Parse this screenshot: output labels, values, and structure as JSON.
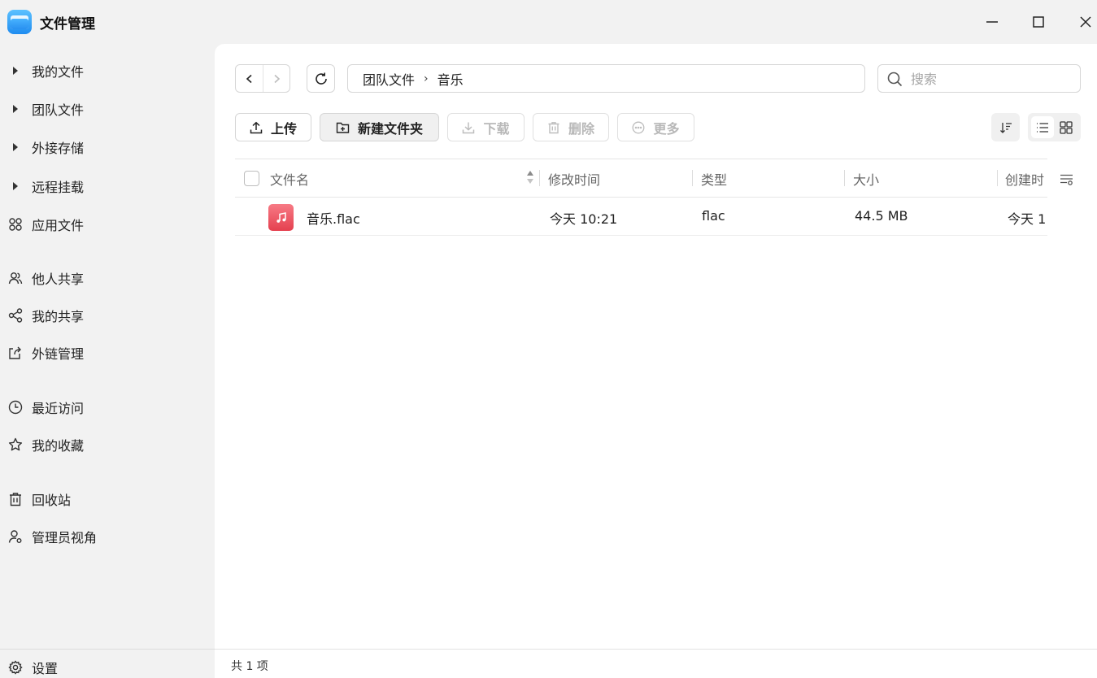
{
  "app": {
    "title": "文件管理"
  },
  "sidebar": {
    "tree_items": [
      {
        "label": "我的文件"
      },
      {
        "label": "团队文件"
      },
      {
        "label": "外接存储"
      },
      {
        "label": "远程挂载"
      }
    ],
    "app_files": {
      "label": "应用文件"
    },
    "share_items": [
      {
        "label": "他人共享"
      },
      {
        "label": "我的共享"
      },
      {
        "label": "外链管理"
      }
    ],
    "recent": {
      "label": "最近访问"
    },
    "favorites": {
      "label": "我的收藏"
    },
    "trash": {
      "label": "回收站"
    },
    "admin_view": {
      "label": "管理员视角"
    },
    "settings": {
      "label": "设置"
    }
  },
  "breadcrumb": [
    "团队文件",
    "音乐"
  ],
  "search": {
    "placeholder": "搜索",
    "value": ""
  },
  "toolbar": {
    "upload": "上传",
    "new_folder": "新建文件夹",
    "download": "下载",
    "delete": "删除",
    "more": "更多"
  },
  "table": {
    "columns": [
      "文件名",
      "修改时间",
      "类型",
      "大小",
      "创建时"
    ],
    "rows": [
      {
        "name": "音乐.flac",
        "modified": "今天 10:21",
        "type": "flac",
        "size": "44.5 MB",
        "created": "今天 1",
        "icon": "music-file-icon"
      }
    ]
  },
  "status": {
    "count_text": "共 1 项"
  },
  "colors": {
    "accent": "#1f8cf0",
    "music_file": "#e5404f",
    "sidebar_bg": "#f2f2f2"
  }
}
